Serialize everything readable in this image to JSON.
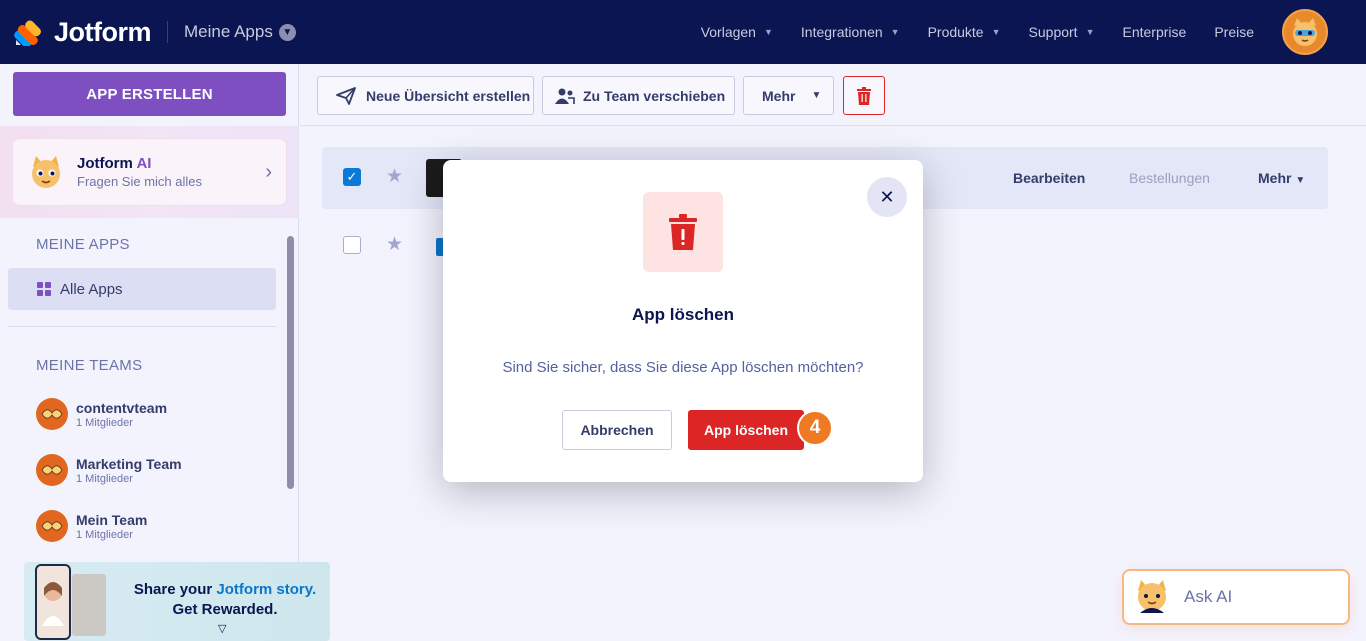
{
  "topnav": {
    "brand": "Jotform",
    "switcher": "Meine Apps",
    "items": [
      "Vorlagen",
      "Integrationen",
      "Produkte",
      "Support",
      "Enterprise",
      "Preise"
    ]
  },
  "sidebar": {
    "create_label": "APP ERSTELLEN",
    "ai_title_a": "Jotform",
    "ai_title_b": "AI",
    "ai_sub": "Fragen Sie mich alles",
    "my_apps_title": "MEINE APPS",
    "all_apps": "Alle Apps",
    "my_teams_title": "MEINE TEAMS",
    "teams": [
      {
        "name": "contentvteam",
        "members": "1 Mitglieder"
      },
      {
        "name": "Marketing Team",
        "members": "1 Mitglieder"
      },
      {
        "name": "Mein Team",
        "members": "1 Mitglieder"
      }
    ],
    "promo_a": "Share your",
    "promo_b": "Jotform story.",
    "promo_c": "Get Rewarded."
  },
  "toolbar": {
    "new_overview": "Neue Übersicht erstellen",
    "move_team": "Zu Team verschieben",
    "more": "Mehr"
  },
  "row": {
    "edit": "Bearbeiten",
    "orders": "Bestellungen",
    "more": "Mehr"
  },
  "modal": {
    "title": "App löschen",
    "text": "Sind Sie sicher, dass Sie diese App löschen möchten?",
    "cancel": "Abbrechen",
    "confirm": "App löschen",
    "step": "4"
  },
  "ask_ai": "Ask AI",
  "colors": {
    "navy": "#0a1551",
    "purple": "#7e4fc1",
    "danger": "#dc2626",
    "step_orange": "#f07a23"
  }
}
